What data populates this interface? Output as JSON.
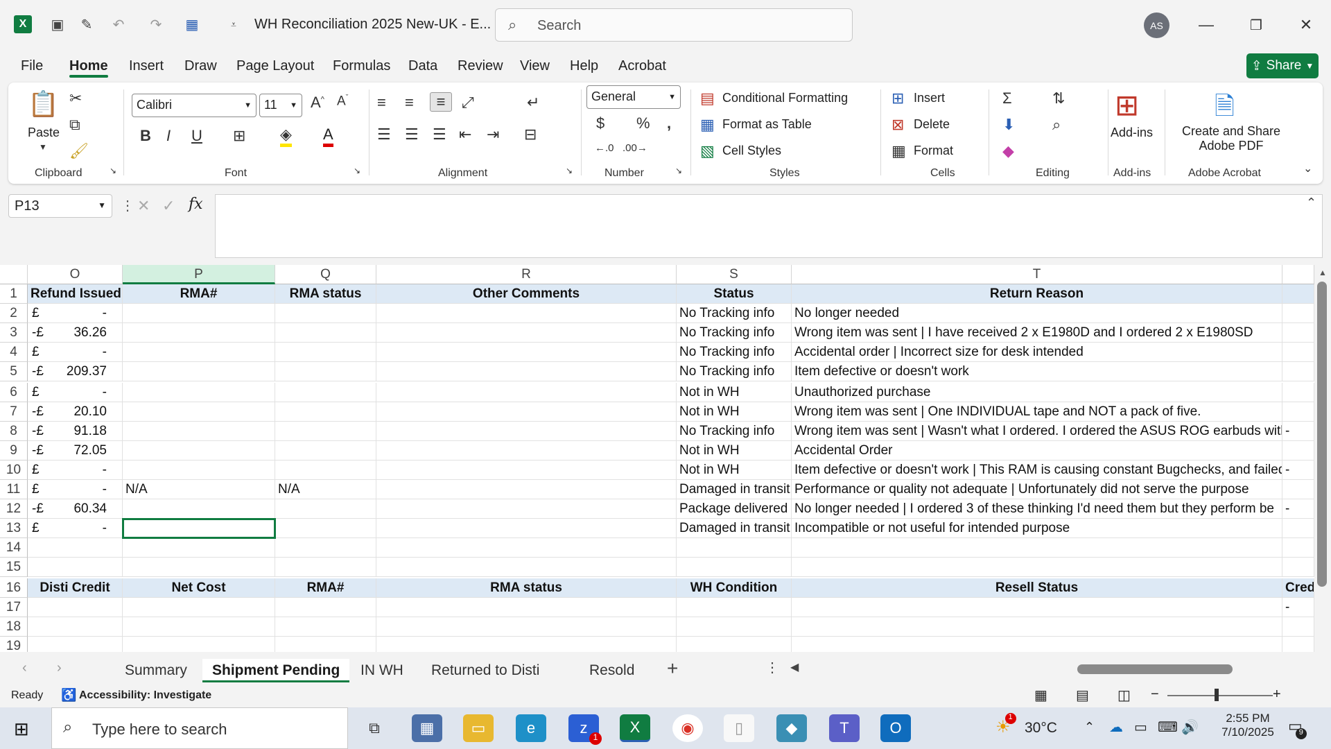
{
  "app": {
    "title": "WH Reconciliation 2025 New-UK  -  E...",
    "search_placeholder": "Search",
    "avatar_initials": "AS",
    "accent": "#107c41"
  },
  "menu": {
    "items": [
      "File",
      "Home",
      "Insert",
      "Draw",
      "Page Layout",
      "Formulas",
      "Data",
      "Review",
      "View",
      "Help",
      "Acrobat"
    ],
    "active": "Home",
    "share_label": "Share"
  },
  "ribbon": {
    "clipboard": {
      "paste": "Paste",
      "label": "Clipboard"
    },
    "font": {
      "name": "Calibri",
      "size": "11",
      "label": "Font"
    },
    "alignment": {
      "label": "Alignment"
    },
    "number": {
      "format": "General",
      "label": "Number"
    },
    "styles": {
      "conditional": "Conditional Formatting",
      "table": "Format as Table",
      "cell": "Cell Styles",
      "label": "Styles"
    },
    "cells": {
      "insert": "Insert",
      "delete": "Delete",
      "format": "Format",
      "label": "Cells"
    },
    "editing": {
      "label": "Editing"
    },
    "addins": {
      "button": "Add-ins",
      "label": "Add-ins"
    },
    "acrobat": {
      "line1": "Create and Share",
      "line2": "Adobe PDF",
      "label": "Adobe Acrobat"
    }
  },
  "formula_bar": {
    "name_box": "P13",
    "fx": "fx",
    "value": ""
  },
  "columns": [
    "O",
    "P",
    "Q",
    "R",
    "S",
    "T"
  ],
  "table1": {
    "headers": [
      "Refund Issued",
      "RMA#",
      "RMA status",
      "Other Comments",
      "Status",
      "Return Reason"
    ],
    "rows": [
      {
        "row": "2",
        "sign": "£",
        "amount": "-",
        "p": "",
        "q": "",
        "status": "No Tracking info",
        "reason": "No longer needed",
        "extra": ""
      },
      {
        "row": "3",
        "sign": "-£",
        "amount": "36.26",
        "p": "",
        "q": "",
        "status": "No Tracking info",
        "reason": "Wrong item was sent | I have received 2 x E1980D and I ordered 2 x E1980SD",
        "extra": ""
      },
      {
        "row": "4",
        "sign": "£",
        "amount": "-",
        "p": "",
        "q": "",
        "status": "No Tracking info",
        "reason": "Accidental order | Incorrect size for desk intended",
        "extra": ""
      },
      {
        "row": "5",
        "sign": "-£",
        "amount": "209.37",
        "p": "",
        "q": "",
        "status": "No Tracking info",
        "reason": "Item defective or doesn't work",
        "extra": ""
      },
      {
        "row": "6",
        "sign": "£",
        "amount": "-",
        "p": "",
        "q": "",
        "status": "Not in WH",
        "reason": "Unauthorized purchase",
        "extra": ""
      },
      {
        "row": "7",
        "sign": "-£",
        "amount": "20.10",
        "p": "",
        "q": "",
        "status": "Not in WH",
        "reason": "Wrong item was sent | One INDIVIDUAL tape and NOT a pack of five.",
        "extra": ""
      },
      {
        "row": "8",
        "sign": "-£",
        "amount": "91.18",
        "p": "",
        "q": "",
        "status": "No Tracking info",
        "reason": "Wrong item was sent | Wasn't what I ordered. I ordered the ASUS ROG earbuds with",
        "extra": "-"
      },
      {
        "row": "9",
        "sign": "-£",
        "amount": "72.05",
        "p": "",
        "q": "",
        "status": "Not in WH",
        "reason": "Accidental Order",
        "extra": ""
      },
      {
        "row": "10",
        "sign": "£",
        "amount": "-",
        "p": "",
        "q": "",
        "status": "Not in WH",
        "reason": "Item defective or doesn't work | This RAM is causing constant Bugchecks, and failed",
        "extra": "-"
      },
      {
        "row": "11",
        "sign": "£",
        "amount": "-",
        "p": "N/A",
        "q": "N/A",
        "status": "Damaged in transit.",
        "reason": "Performance or quality not adequate | Unfortunately did not serve the purpose",
        "extra": ""
      },
      {
        "row": "12",
        "sign": "-£",
        "amount": "60.34",
        "p": "",
        "q": "",
        "status": "Package delivered to",
        "reason": "No longer needed | I ordered 3 of these thinking I'd need them but they perform be",
        "extra": "-"
      },
      {
        "row": "13",
        "sign": "£",
        "amount": "-",
        "p": "",
        "q": "",
        "status": "Damaged in transit.",
        "reason": "Incompatible or not useful for intended purpose",
        "extra": ""
      }
    ]
  },
  "table2": {
    "headers": [
      "Disti Credit",
      "Net Cost",
      "RMA#",
      "RMA status",
      "WH Condition",
      "Resell Status",
      "Cred"
    ],
    "row17_extra": "-"
  },
  "row_numbers": [
    "1",
    "2",
    "3",
    "4",
    "5",
    "6",
    "7",
    "8",
    "9",
    "10",
    "11",
    "12",
    "13",
    "14",
    "15",
    "16",
    "17",
    "18",
    "19"
  ],
  "sheets": {
    "tabs": [
      "Summary",
      "Shipment Pending",
      "IN WH",
      "Returned to Disti",
      "Resold"
    ],
    "active": "Shipment Pending"
  },
  "status": {
    "ready": "Ready",
    "accessibility": "Accessibility: Investigate"
  },
  "taskbar": {
    "search_placeholder": "Type here to search",
    "temperature": "30°C",
    "time": "2:55 PM",
    "date": "7/10/2025",
    "notif_count": "9",
    "weather_badge": "1",
    "zoom_badge": "1"
  }
}
